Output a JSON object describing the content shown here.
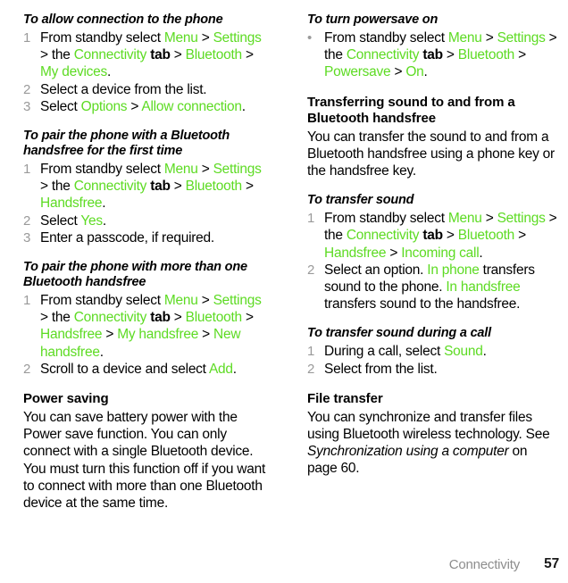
{
  "document": {
    "page_number": "57",
    "section_name": "Connectivity"
  },
  "colors": {
    "link_green": "#5ddb23",
    "marker_gray": "#9a9a9a",
    "footer_gray": "#8d8d8d",
    "text_black": "#000000"
  },
  "left_column": {
    "sections": [
      {
        "heading": "To allow connection to the phone",
        "heading_style": "bold-italic",
        "steps": [
          {
            "marker": "1",
            "runs": [
              {
                "t": "From standby select ",
                "s": "plain"
              },
              {
                "t": "Menu",
                "s": "green"
              },
              {
                "t": " > ",
                "s": "plain"
              },
              {
                "t": "Settings",
                "s": "green"
              },
              {
                "t": " > the ",
                "s": "plain"
              },
              {
                "t": "Connectivity",
                "s": "green"
              },
              {
                "t": " tab",
                "s": "bold"
              },
              {
                "t": " > ",
                "s": "plain"
              },
              {
                "t": "Bluetooth",
                "s": "green"
              },
              {
                "t": " > ",
                "s": "plain"
              },
              {
                "t": "My devices",
                "s": "green"
              },
              {
                "t": ".",
                "s": "plain"
              }
            ]
          },
          {
            "marker": "2",
            "runs": [
              {
                "t": "Select a device from the list.",
                "s": "plain"
              }
            ]
          },
          {
            "marker": "3",
            "runs": [
              {
                "t": "Select ",
                "s": "plain"
              },
              {
                "t": "Options",
                "s": "green"
              },
              {
                "t": " > ",
                "s": "plain"
              },
              {
                "t": "Allow connection",
                "s": "green"
              },
              {
                "t": ".",
                "s": "plain"
              }
            ]
          }
        ]
      },
      {
        "heading": "To pair the phone with a Bluetooth handsfree for the first time",
        "heading_style": "bold-italic",
        "steps": [
          {
            "marker": "1",
            "runs": [
              {
                "t": "From standby select ",
                "s": "plain"
              },
              {
                "t": "Menu",
                "s": "green"
              },
              {
                "t": " > ",
                "s": "plain"
              },
              {
                "t": "Settings",
                "s": "green"
              },
              {
                "t": " > the ",
                "s": "plain"
              },
              {
                "t": "Connectivity",
                "s": "green"
              },
              {
                "t": " tab",
                "s": "bold"
              },
              {
                "t": " > ",
                "s": "plain"
              },
              {
                "t": "Bluetooth",
                "s": "green"
              },
              {
                "t": " > ",
                "s": "plain"
              },
              {
                "t": "Handsfree",
                "s": "green"
              },
              {
                "t": ".",
                "s": "plain"
              }
            ]
          },
          {
            "marker": "2",
            "runs": [
              {
                "t": "Select ",
                "s": "plain"
              },
              {
                "t": "Yes",
                "s": "green"
              },
              {
                "t": ".",
                "s": "plain"
              }
            ]
          },
          {
            "marker": "3",
            "runs": [
              {
                "t": "Enter a passcode, if required.",
                "s": "plain"
              }
            ]
          }
        ]
      },
      {
        "heading": "To pair the phone with more than one Bluetooth handsfree",
        "heading_style": "bold-italic",
        "steps": [
          {
            "marker": "1",
            "runs": [
              {
                "t": "From standby select ",
                "s": "plain"
              },
              {
                "t": "Menu",
                "s": "green"
              },
              {
                "t": " > ",
                "s": "plain"
              },
              {
                "t": "Settings",
                "s": "green"
              },
              {
                "t": " > the ",
                "s": "plain"
              },
              {
                "t": "Connectivity",
                "s": "green"
              },
              {
                "t": " tab",
                "s": "bold"
              },
              {
                "t": " > ",
                "s": "plain"
              },
              {
                "t": "Bluetooth",
                "s": "green"
              },
              {
                "t": " > ",
                "s": "plain"
              },
              {
                "t": "Handsfree",
                "s": "green"
              },
              {
                "t": " > ",
                "s": "plain"
              },
              {
                "t": "My handsfree",
                "s": "green"
              },
              {
                "t": " > ",
                "s": "plain"
              },
              {
                "t": "New handsfree",
                "s": "green"
              },
              {
                "t": ".",
                "s": "plain"
              }
            ]
          },
          {
            "marker": "2",
            "runs": [
              {
                "t": "Scroll to a device and select ",
                "s": "plain"
              },
              {
                "t": "Add",
                "s": "green"
              },
              {
                "t": ".",
                "s": "plain"
              }
            ]
          }
        ]
      },
      {
        "heading": "Power saving",
        "heading_style": "bold",
        "paragraphs": [
          {
            "runs": [
              {
                "t": "You can save battery power with the Power save function. You can only connect with a single Bluetooth device. You must turn this function off if you want to connect with more than one Bluetooth device at the same time.",
                "s": "plain"
              }
            ]
          }
        ]
      }
    ]
  },
  "right_column": {
    "sections": [
      {
        "heading": "To turn powersave on",
        "heading_style": "bold-italic",
        "steps": [
          {
            "marker": "•",
            "runs": [
              {
                "t": "From standby select ",
                "s": "plain"
              },
              {
                "t": "Menu",
                "s": "green"
              },
              {
                "t": " > ",
                "s": "plain"
              },
              {
                "t": "Settings",
                "s": "green"
              },
              {
                "t": " > the ",
                "s": "plain"
              },
              {
                "t": "Connectivity",
                "s": "green"
              },
              {
                "t": " tab",
                "s": "bold"
              },
              {
                "t": " > ",
                "s": "plain"
              },
              {
                "t": "Bluetooth",
                "s": "green"
              },
              {
                "t": " > ",
                "s": "plain"
              },
              {
                "t": "Powersave",
                "s": "green"
              },
              {
                "t": " > ",
                "s": "plain"
              },
              {
                "t": "On",
                "s": "green"
              },
              {
                "t": ".",
                "s": "plain"
              }
            ]
          }
        ]
      },
      {
        "heading": "Transferring sound to and from a Bluetooth handsfree",
        "heading_style": "bold",
        "paragraphs": [
          {
            "runs": [
              {
                "t": "You can transfer the sound to and from a Bluetooth handsfree using a phone key or the handsfree key.",
                "s": "plain"
              }
            ]
          }
        ]
      },
      {
        "heading": "To transfer sound",
        "heading_style": "bold-italic",
        "steps": [
          {
            "marker": "1",
            "runs": [
              {
                "t": "From standby select ",
                "s": "plain"
              },
              {
                "t": "Menu",
                "s": "green"
              },
              {
                "t": " > ",
                "s": "plain"
              },
              {
                "t": "Settings",
                "s": "green"
              },
              {
                "t": " > the ",
                "s": "plain"
              },
              {
                "t": "Connectivity",
                "s": "green"
              },
              {
                "t": " tab",
                "s": "bold"
              },
              {
                "t": " > ",
                "s": "plain"
              },
              {
                "t": "Bluetooth",
                "s": "green"
              },
              {
                "t": " > ",
                "s": "plain"
              },
              {
                "t": "Handsfree",
                "s": "green"
              },
              {
                "t": " > ",
                "s": "plain"
              },
              {
                "t": "Incoming call",
                "s": "green"
              },
              {
                "t": ".",
                "s": "plain"
              }
            ]
          },
          {
            "marker": "2",
            "runs": [
              {
                "t": "Select an option. ",
                "s": "plain"
              },
              {
                "t": "In phone",
                "s": "green"
              },
              {
                "t": " transfers sound to the phone. ",
                "s": "plain"
              },
              {
                "t": "In handsfree",
                "s": "green"
              },
              {
                "t": " transfers sound to the handsfree.",
                "s": "plain"
              }
            ]
          }
        ]
      },
      {
        "heading": "To transfer sound during a call",
        "heading_style": "bold-italic",
        "steps": [
          {
            "marker": "1",
            "runs": [
              {
                "t": "During a call, select ",
                "s": "plain"
              },
              {
                "t": "Sound",
                "s": "green"
              },
              {
                "t": ".",
                "s": "plain"
              }
            ]
          },
          {
            "marker": "2",
            "runs": [
              {
                "t": "Select from the list.",
                "s": "plain"
              }
            ]
          }
        ]
      },
      {
        "heading": "File transfer",
        "heading_style": "bold",
        "paragraphs": [
          {
            "runs": [
              {
                "t": "You can synchronize and transfer files using Bluetooth wireless technology. See ",
                "s": "plain"
              },
              {
                "t": "Synchronization using a computer",
                "s": "italic"
              },
              {
                "t": " on page 60.",
                "s": "plain"
              }
            ]
          }
        ]
      }
    ]
  }
}
